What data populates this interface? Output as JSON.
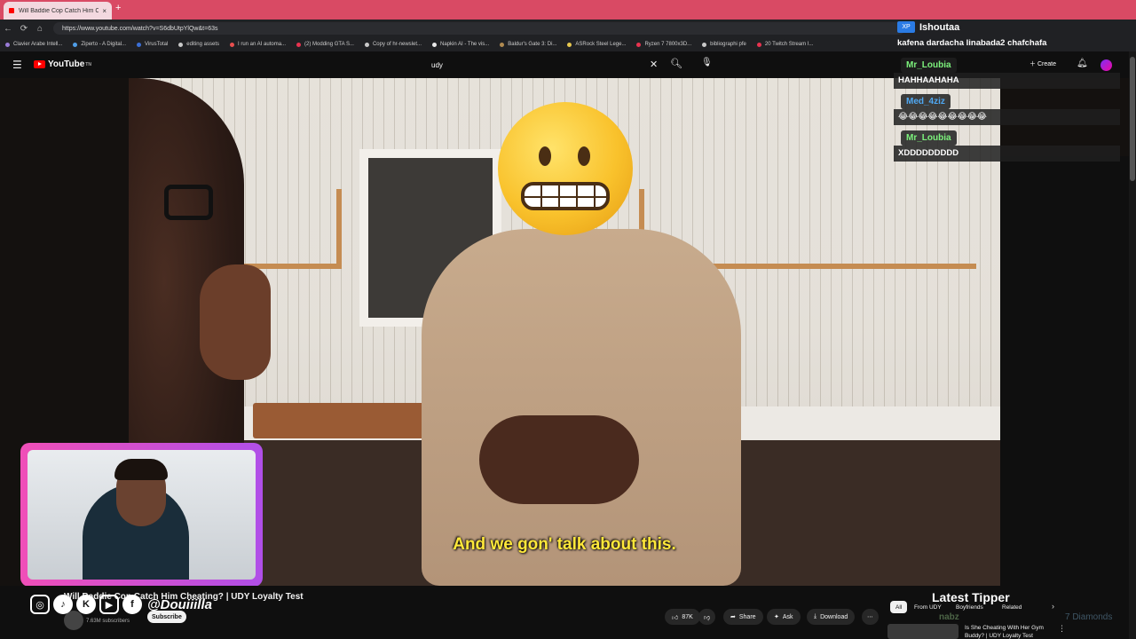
{
  "browser": {
    "tab_title": "Will Baddie Cop Catch Him Cheatin...",
    "tab_close": "×",
    "new_tab": "+",
    "url": "https://www.youtube.com/watch?v=S6dbUtpYlQw&t=63s",
    "bookmarks": [
      {
        "label": "Clavier Arabe Intell...",
        "color": "#9a7cd8"
      },
      {
        "label": "Ziperto - A Digital...",
        "color": "#4f9ee8"
      },
      {
        "label": "VirusTotal",
        "color": "#3b6fd6"
      },
      {
        "label": "editing assets",
        "color": "#c9c9c9"
      },
      {
        "label": "I run an AI automa...",
        "color": "#e84f4f"
      },
      {
        "label": "(2) Modding GTA S...",
        "color": "#e8334f"
      },
      {
        "label": "Copy of hr-newslet...",
        "color": "#c9c9c9"
      },
      {
        "label": "Napkin AI - The vis...",
        "color": "#e8e8e8"
      },
      {
        "label": "Baldur's Gate 3: Di...",
        "color": "#b08a50"
      },
      {
        "label": "ASRock Steel Lege...",
        "color": "#e8c84f"
      },
      {
        "label": "Ryzen 7 7800x3D...",
        "color": "#e8334f"
      },
      {
        "label": "bibliographi pfe",
        "color": "#c9c9c9"
      },
      {
        "label": "20 Twitch Stream I...",
        "color": "#e8334f"
      }
    ]
  },
  "youtube": {
    "logo": "YouTube",
    "logo_sup": "TN",
    "search_value": "udy",
    "create_label": "Create"
  },
  "video": {
    "subtitle": "And we gon' talk about this.",
    "title": "Will Baddie Cop Catch Him Cheating? | UDY Loyalty Test",
    "subscribers": "7.63M subscribers",
    "subscribe_label": "Subscribe",
    "likes": "87K",
    "share_label": "Share",
    "ask_label": "Ask",
    "download_label": "Download"
  },
  "stream_overlay": {
    "social_handle": "@Douiiilla",
    "latest_tipper_label": "Latest Tipper",
    "tipper_name": "nabz",
    "tipper_amount": "7 Diamonds"
  },
  "chat": {
    "head_badge": "XP",
    "head_user": "Ishoutaa",
    "head_message": "kafena dardacha linabada2 chafchafa",
    "messages": [
      {
        "user": "Mr_Loubia",
        "user_color": "#7cf27c",
        "text": "HAHHAAHAHA"
      },
      {
        "user": "Med_4ziz",
        "user_color": "#4fa8f2",
        "text": "😂😂😂😂😂😂😂😂😂"
      },
      {
        "user": "Mr_Loubia",
        "user_color": "#7cf27c",
        "text": "XDDDDDDDDD"
      }
    ]
  },
  "chips": [
    {
      "label": "All",
      "active": true
    },
    {
      "label": "From UDY",
      "active": false
    },
    {
      "label": "Boyfriends",
      "active": false
    },
    {
      "label": "Related",
      "active": false
    }
  ],
  "recommendation": {
    "title": "Is She Cheating With Her Gym Buddy? | UDY Loyalty Test"
  }
}
